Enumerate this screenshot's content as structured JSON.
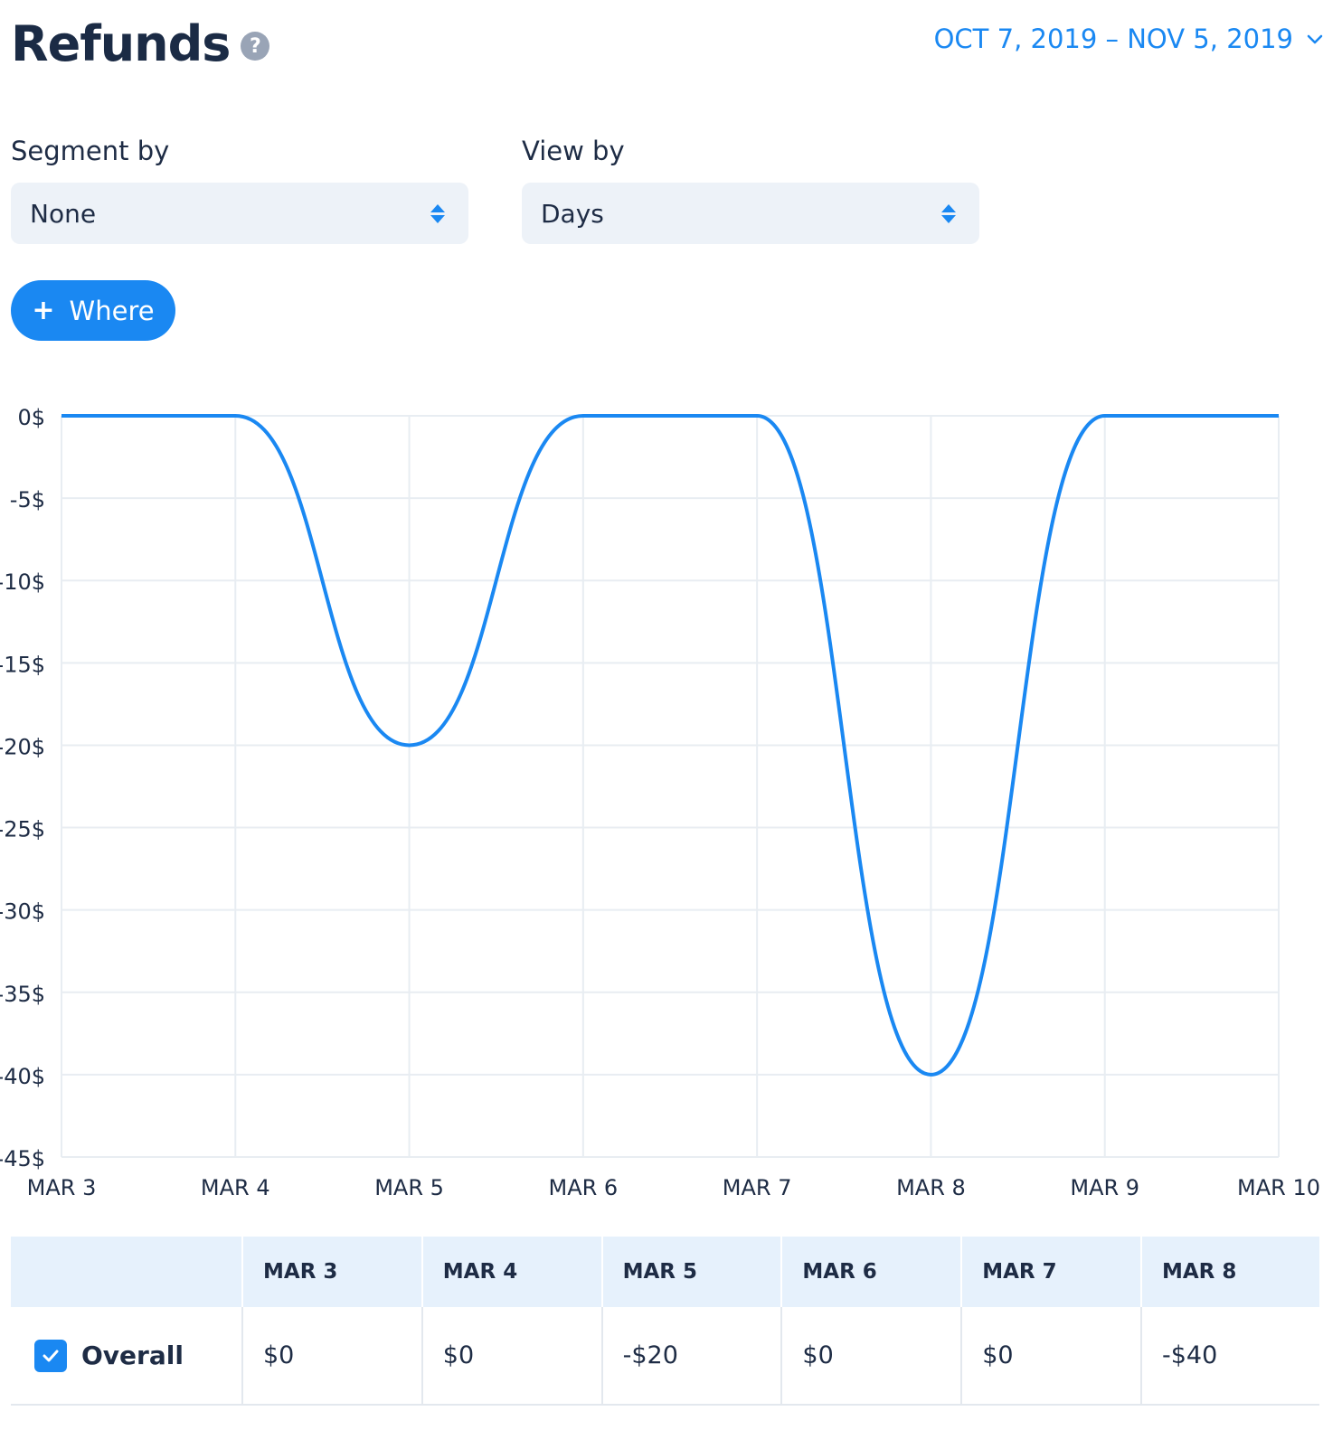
{
  "header": {
    "title": "Refunds",
    "help_icon": "?",
    "date_range": "OCT 7, 2019 – NOV 5, 2019"
  },
  "filters": {
    "segment_label": "Segment by",
    "segment_value": "None",
    "view_label": "View by",
    "view_value": "Days",
    "where_label": "Where",
    "where_plus": "+"
  },
  "colors": {
    "accent": "#1a88f2",
    "grid": "#e8edf2",
    "select_bg": "#edf2f8",
    "table_header_bg": "#e6f1fc"
  },
  "chart_data": {
    "type": "line",
    "categories": [
      "MAR 3",
      "MAR 4",
      "MAR 5",
      "MAR 6",
      "MAR 7",
      "MAR 8",
      "MAR 9",
      "MAR 10"
    ],
    "series": [
      {
        "values": [
          0,
          0,
          -20,
          0,
          0,
          -40,
          0,
          0
        ]
      }
    ],
    "y_ticks": [
      "0$",
      "-5$",
      "-10$",
      "-15$",
      "-20$",
      "-25$",
      "-30$",
      "-35$",
      "-40$",
      "-45$"
    ],
    "ylim": [
      -45,
      0
    ],
    "grid": true,
    "curve": "smooth"
  },
  "table": {
    "columns": [
      "MAR 3",
      "MAR 4",
      "MAR 5",
      "MAR 6",
      "MAR 7",
      "MAR 8"
    ],
    "rows": [
      {
        "label": "Overall",
        "checked": true,
        "values": [
          "$0",
          "$0",
          "-$20",
          "$0",
          "$0",
          "-$40"
        ]
      }
    ]
  }
}
